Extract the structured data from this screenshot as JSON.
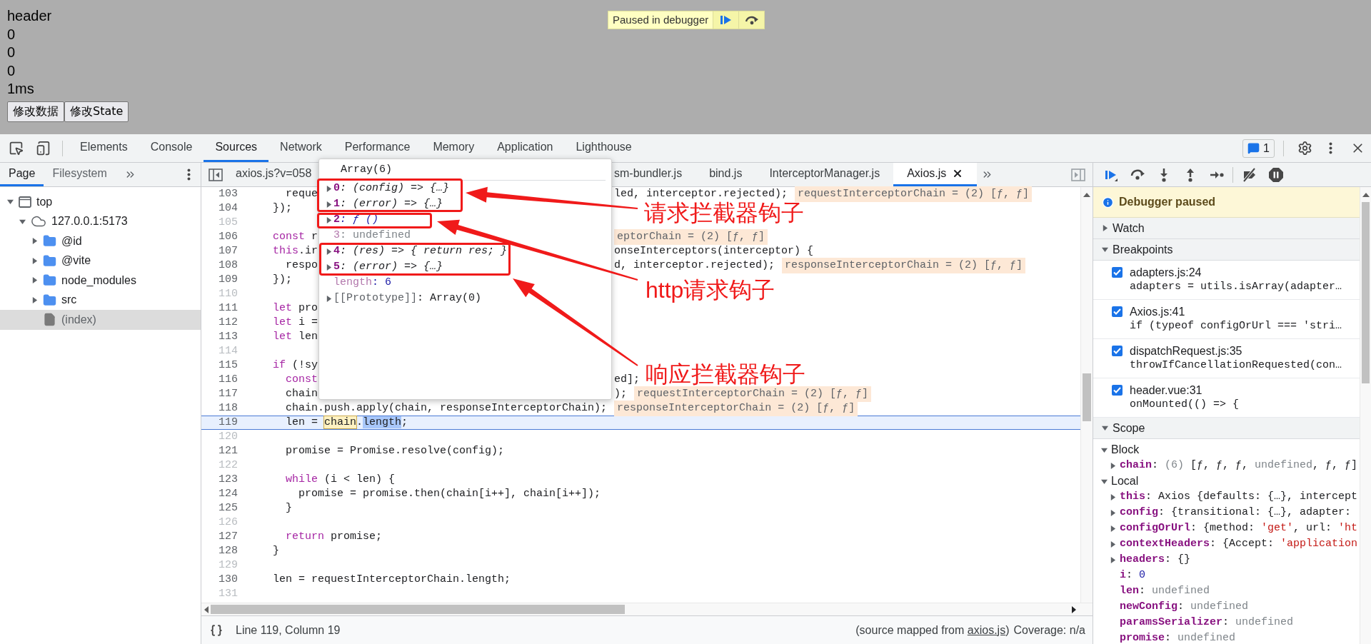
{
  "page": {
    "lines": [
      "header",
      "0",
      "0",
      "0",
      "1ms"
    ],
    "buttons": [
      "修改数据",
      "修改State"
    ]
  },
  "paused_overlay": {
    "message": "Paused in debugger"
  },
  "devtools": {
    "tabs": [
      {
        "label": "Elements",
        "selected": false
      },
      {
        "label": "Console",
        "selected": false
      },
      {
        "label": "Sources",
        "selected": true
      },
      {
        "label": "Network",
        "selected": false
      },
      {
        "label": "Performance",
        "selected": false
      },
      {
        "label": "Memory",
        "selected": false
      },
      {
        "label": "Application",
        "selected": false
      },
      {
        "label": "Lighthouse",
        "selected": false
      }
    ],
    "issues_count": "1"
  },
  "navigator": {
    "tabs": [
      {
        "label": "Page",
        "selected": true
      },
      {
        "label": "Filesystem",
        "selected": false
      }
    ],
    "tree": [
      {
        "label": "top",
        "kind": "frame",
        "expanded": true,
        "selected": false,
        "children": [
          {
            "label": "127.0.0.1:5173",
            "kind": "origin",
            "expanded": true,
            "selected": false,
            "children": [
              {
                "label": "@id",
                "kind": "folder",
                "expanded": false,
                "selected": false
              },
              {
                "label": "@vite",
                "kind": "folder",
                "expanded": false,
                "selected": false
              },
              {
                "label": "node_modules",
                "kind": "folder",
                "expanded": false,
                "selected": false
              },
              {
                "label": "src",
                "kind": "folder",
                "expanded": false,
                "selected": false
              },
              {
                "label": "(index)",
                "kind": "file",
                "selected": true
              }
            ]
          }
        ]
      }
    ]
  },
  "editor": {
    "file_tabs": [
      {
        "label": "axios.js?v=058",
        "selected": false
      },
      {
        "label": "sm-bundler.js",
        "selected": false
      },
      {
        "label": "bind.js",
        "selected": false
      },
      {
        "label": "InterceptorManager.js",
        "selected": false
      },
      {
        "label": "Axios.js",
        "selected": true
      }
    ],
    "lines": [
      {
        "number": "103",
        "current": false,
        "code": [
          {
            "kind": "plain",
            "text": "      reque"
          }
        ],
        "right": [
          {
            "kind": "plain",
            "text": "led, interceptor.rejected);"
          },
          {
            "kind": "value",
            "text": "requestInterceptorChain = (2) [ƒ, ƒ]"
          }
        ]
      },
      {
        "number": "104",
        "current": false,
        "code": [
          {
            "kind": "plain",
            "text": "    });"
          }
        ]
      },
      {
        "number": "105",
        "current": false
      },
      {
        "number": "106",
        "current": false,
        "code": [
          {
            "kind": "kw",
            "text": "    const"
          },
          {
            "kind": "plain",
            "text": " r"
          }
        ],
        "right": [
          {
            "kind": "value",
            "text": "eptorChain = (2) [ƒ, ƒ]"
          }
        ]
      },
      {
        "number": "107",
        "current": false,
        "code": [
          {
            "kind": "kw",
            "text": "    this"
          },
          {
            "kind": "plain",
            "text": ".ir"
          }
        ],
        "right": [
          {
            "kind": "plain",
            "text": "onseInterceptors(interceptor) {"
          }
        ]
      },
      {
        "number": "108",
        "current": false,
        "code": [
          {
            "kind": "plain",
            "text": "      respo"
          }
        ],
        "right": [
          {
            "kind": "plain",
            "text": "d, interceptor.rejected);"
          },
          {
            "kind": "value",
            "text": "responseInterceptorChain = (2) [ƒ, ƒ]"
          }
        ]
      },
      {
        "number": "109",
        "current": false,
        "code": [
          {
            "kind": "plain",
            "text": "    });"
          }
        ]
      },
      {
        "number": "110",
        "current": false
      },
      {
        "number": "111",
        "current": false,
        "code": [
          {
            "kind": "kw",
            "text": "    let"
          },
          {
            "kind": "plain",
            "text": " pro"
          }
        ]
      },
      {
        "number": "112",
        "current": false,
        "code": [
          {
            "kind": "kw",
            "text": "    let"
          },
          {
            "kind": "plain",
            "text": " i ="
          }
        ]
      },
      {
        "number": "113",
        "current": false,
        "code": [
          {
            "kind": "kw",
            "text": "    let"
          },
          {
            "kind": "plain",
            "text": " len"
          }
        ]
      },
      {
        "number": "114",
        "current": false
      },
      {
        "number": "115",
        "current": false,
        "code": [
          {
            "kind": "kw",
            "text": "    if"
          },
          {
            "kind": "plain",
            "text": " (!sy"
          }
        ]
      },
      {
        "number": "116",
        "current": false,
        "code": [
          {
            "kind": "kw",
            "text": "      const"
          }
        ],
        "right": [
          {
            "kind": "plain",
            "text": "ed];"
          }
        ]
      },
      {
        "number": "117",
        "current": false,
        "code": [
          {
            "kind": "plain",
            "text": "      chain"
          }
        ],
        "right": [
          {
            "kind": "plain",
            "text": ");"
          },
          {
            "kind": "value",
            "text": "requestInterceptorChain = (2) [ƒ, ƒ]"
          }
        ]
      },
      {
        "number": "118",
        "current": false,
        "code": [
          {
            "kind": "plain",
            "text": "      chain.push.apply(chain, responseInterceptorChain);"
          },
          {
            "kind": "value",
            "text": "responseInterceptorChain = (2) [ƒ, ƒ]"
          }
        ]
      },
      {
        "number": "119",
        "current": true,
        "code": [
          {
            "kind": "plain",
            "text": "      len = "
          },
          {
            "kind": "hover",
            "text": "chain"
          },
          {
            "kind": "plain",
            "text": "."
          },
          {
            "kind": "sel",
            "text": "length"
          },
          {
            "kind": "plain",
            "text": ";"
          }
        ]
      },
      {
        "number": "120",
        "current": false
      },
      {
        "number": "121",
        "current": false,
        "code": [
          {
            "kind": "plain",
            "text": "      promise = Promise.resolve(config);"
          }
        ]
      },
      {
        "number": "122",
        "current": false
      },
      {
        "number": "123",
        "current": false,
        "code": [
          {
            "kind": "kw",
            "text": "      while"
          },
          {
            "kind": "plain",
            "text": " (i < len) {"
          }
        ]
      },
      {
        "number": "124",
        "current": false,
        "code": [
          {
            "kind": "plain",
            "text": "        promise = promise.then(chain[i++], chain[i++]);"
          }
        ]
      },
      {
        "number": "125",
        "current": false,
        "code": [
          {
            "kind": "plain",
            "text": "      }"
          }
        ]
      },
      {
        "number": "126",
        "current": false
      },
      {
        "number": "127",
        "current": false,
        "code": [
          {
            "kind": "kw",
            "text": "      return"
          },
          {
            "kind": "plain",
            "text": " promise;"
          }
        ]
      },
      {
        "number": "128",
        "current": false,
        "code": [
          {
            "kind": "plain",
            "text": "    }"
          }
        ]
      },
      {
        "number": "129",
        "current": false
      },
      {
        "number": "130",
        "current": false,
        "code": [
          {
            "kind": "plain",
            "text": "    len = requestInterceptorChain.length;"
          }
        ]
      },
      {
        "number": "131",
        "current": false
      }
    ],
    "popup": {
      "title": "Array(6)",
      "items": [
        {
          "key": "0",
          "value": ": (config) => {…}",
          "kind": "fn",
          "expandable": true
        },
        {
          "key": "1",
          "value": ": (error) => {…}",
          "kind": "fn",
          "expandable": true
        },
        {
          "key": "2",
          "value": ": ƒ ()",
          "kind": "native",
          "expandable": true
        },
        {
          "key": "3",
          "value": ": undefined",
          "kind": "undefined",
          "expandable": false
        },
        {
          "key": "4",
          "value": ": (res) => { return res; }",
          "kind": "fn",
          "expandable": true
        },
        {
          "key": "5",
          "value": ": (error) => {…}",
          "kind": "fn",
          "expandable": true
        },
        {
          "key": "length",
          "value": ": 6",
          "kind": "count",
          "expandable": false
        },
        {
          "key": "[[Prototype]]",
          "value": ": Array(0)",
          "kind": "internal",
          "expandable": true
        }
      ]
    },
    "annotations": [
      "请求拦截器钩子",
      "http请求钩子",
      "响应拦截器钩子"
    ]
  },
  "status_bar": {
    "position": "Line 119, Column 19",
    "source_note": "(source mapped from ",
    "source_link": "axios.js",
    "source_close": ")",
    "coverage": "Coverage: n/a"
  },
  "debugger": {
    "paused_message": "Debugger paused",
    "watch": {
      "title": "Watch",
      "expanded": false
    },
    "breakpoints": {
      "title": "Breakpoints",
      "expanded": true,
      "items": [
        {
          "file": "adapters.js:24",
          "code": "adapters = utils.isArray(adapter…",
          "checked": true
        },
        {
          "file": "Axios.js:41",
          "code": "if (typeof configOrUrl === 'stri…",
          "checked": true
        },
        {
          "file": "dispatchRequest.js:35",
          "code": "throwIfCancellationRequested(con…",
          "checked": true
        },
        {
          "file": "header.vue:31",
          "code": "onMounted(() => {",
          "checked": true
        }
      ]
    },
    "scope": {
      "title": "Scope",
      "expanded": true,
      "groups": [
        {
          "name": "Block",
          "expanded": true,
          "items": [
            {
              "name": "chain",
              "expandable": true,
              "value": [
                {
                  "kind": "plain",
                  "text": ": "
                },
                {
                  "kind": "dim",
                  "text": "(6)"
                },
                {
                  "kind": "plain",
                  "text": " [ƒ, ƒ, ƒ, "
                },
                {
                  "kind": "dim",
                  "text": "undefined"
                },
                {
                  "kind": "plain",
                  "text": ", ƒ, ƒ]"
                }
              ]
            }
          ]
        },
        {
          "name": "Local",
          "expanded": true,
          "items": [
            {
              "name": "this",
              "expandable": true,
              "value": [
                {
                  "kind": "plain",
                  "text": ": Axios {defaults: {…}, intercept"
                }
              ]
            },
            {
              "name": "config",
              "expandable": true,
              "value": [
                {
                  "kind": "plain",
                  "text": ": {transitional: {…}, adapter:"
                }
              ]
            },
            {
              "name": "configOrUrl",
              "expandable": true,
              "value": [
                {
                  "kind": "plain",
                  "text": ": {method: "
                },
                {
                  "kind": "string",
                  "text": "'get'"
                },
                {
                  "kind": "plain",
                  "text": ", url: "
                },
                {
                  "kind": "string",
                  "text": "'ht"
                }
              ]
            },
            {
              "name": "contextHeaders",
              "expandable": true,
              "value": [
                {
                  "kind": "plain",
                  "text": ": {Accept: "
                },
                {
                  "kind": "string",
                  "text": "'application"
                }
              ]
            },
            {
              "name": "headers",
              "expandable": true,
              "value": [
                {
                  "kind": "plain",
                  "text": ": {}"
                }
              ]
            },
            {
              "name": "i",
              "expandable": false,
              "value": [
                {
                  "kind": "plain",
                  "text": ": "
                },
                {
                  "kind": "number",
                  "text": "0"
                }
              ]
            },
            {
              "name": "len",
              "expandable": false,
              "value": [
                {
                  "kind": "plain",
                  "text": ": "
                },
                {
                  "kind": "dim",
                  "text": "undefined"
                }
              ]
            },
            {
              "name": "newConfig",
              "expandable": false,
              "value": [
                {
                  "kind": "plain",
                  "text": ": "
                },
                {
                  "kind": "dim",
                  "text": "undefined"
                }
              ]
            },
            {
              "name": "paramsSerializer",
              "expandable": false,
              "value": [
                {
                  "kind": "plain",
                  "text": ": "
                },
                {
                  "kind": "dim",
                  "text": "undefined"
                }
              ]
            },
            {
              "name": "promise",
              "expandable": false,
              "value": [
                {
                  "kind": "plain",
                  "text": ": "
                },
                {
                  "kind": "dim",
                  "text": "undefined"
                }
              ]
            }
          ]
        }
      ]
    }
  }
}
